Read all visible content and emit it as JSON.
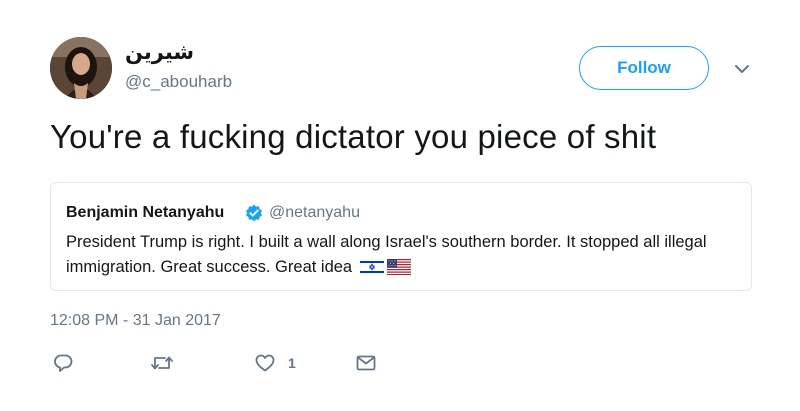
{
  "author": {
    "display_name": "شيرين",
    "handle": "@c_abouharb"
  },
  "follow_button": {
    "label": "Follow"
  },
  "tweet": {
    "text": "You're a fucking dictator you piece of shit",
    "timestamp": "12:08 PM - 31 Jan 2017"
  },
  "quoted_tweet": {
    "author_name": "Benjamin Netanyahu",
    "handle": "@netanyahu",
    "text": "President Trump is right. I built a wall along Israel's southern border. It stopped all illegal immigration. Great success. Great idea",
    "emoji_flags": [
      "israel-flag",
      "usa-flag"
    ]
  },
  "actions": {
    "reply_icon": "reply-icon",
    "retweet_icon": "retweet-icon",
    "like_icon": "heart-icon",
    "like_count": "1",
    "message_icon": "envelope-icon"
  },
  "colors": {
    "accent": "#1da1f2",
    "muted_text": "#657786",
    "border": "#e1e8ed"
  }
}
